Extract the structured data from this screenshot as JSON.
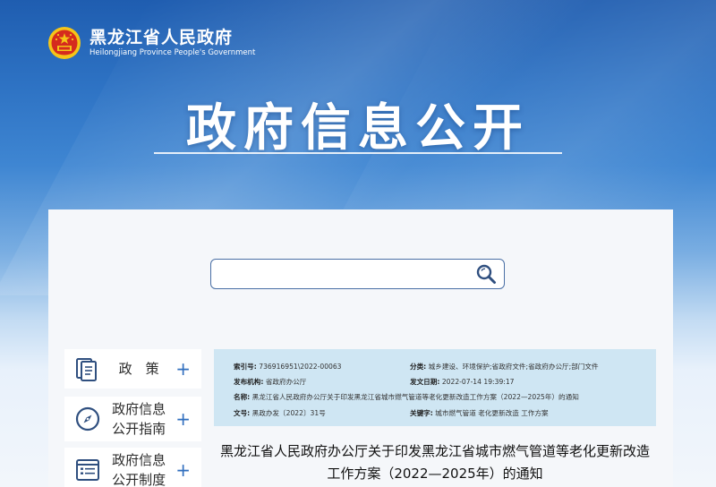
{
  "site": {
    "name_cn": "黑龙江省人民政府",
    "name_en": "Heilongjiang Province People's Government"
  },
  "banner": {
    "title": "政府信息公开"
  },
  "search": {
    "placeholder": "",
    "value": ""
  },
  "sidebar": {
    "items": [
      {
        "label_line1": "政　策",
        "label_line2": "",
        "icon": "document-stack-icon"
      },
      {
        "label_line1": "政府信息",
        "label_line2": "公开指南",
        "icon": "compass-icon"
      },
      {
        "label_line1": "政府信息",
        "label_line2": "公开制度",
        "icon": "list-icon"
      }
    ]
  },
  "doc_meta": {
    "index_label": "索引号:",
    "index_value": "736916951\\2022-00063",
    "category_label": "分类:",
    "category_value": "城乡建设、环境保护;省政府文件;省政府办公厅;部门文件",
    "issuer_label": "发布机构:",
    "issuer_value": "省政府办公厅",
    "date_label": "发文日期:",
    "date_value": "2022-07-14 19:39:17",
    "name_label": "名称:",
    "name_value": "黑龙江省人民政府办公厅关于印发黑龙江省城市燃气管道等老化更新改造工作方案（2022—2025年）的通知",
    "docno_label": "文号:",
    "docno_value": "黑政办发〔2022〕31号",
    "keywords_label": "关键字:",
    "keywords_value": "城市燃气管道 老化更新改造 工作方案"
  },
  "document": {
    "title_line1": "黑龙江省人民政府办公厅关于印发黑龙江省城市燃气管道等老化更新改造",
    "title_line2": "工作方案（2022—2025年）的通知"
  },
  "colors": {
    "header_blue": "#1f5db0",
    "accent_blue": "#2f6ebe",
    "meta_bg": "#cfe6f3",
    "emblem_red": "#d52b1e",
    "emblem_gold": "#f5c518"
  }
}
